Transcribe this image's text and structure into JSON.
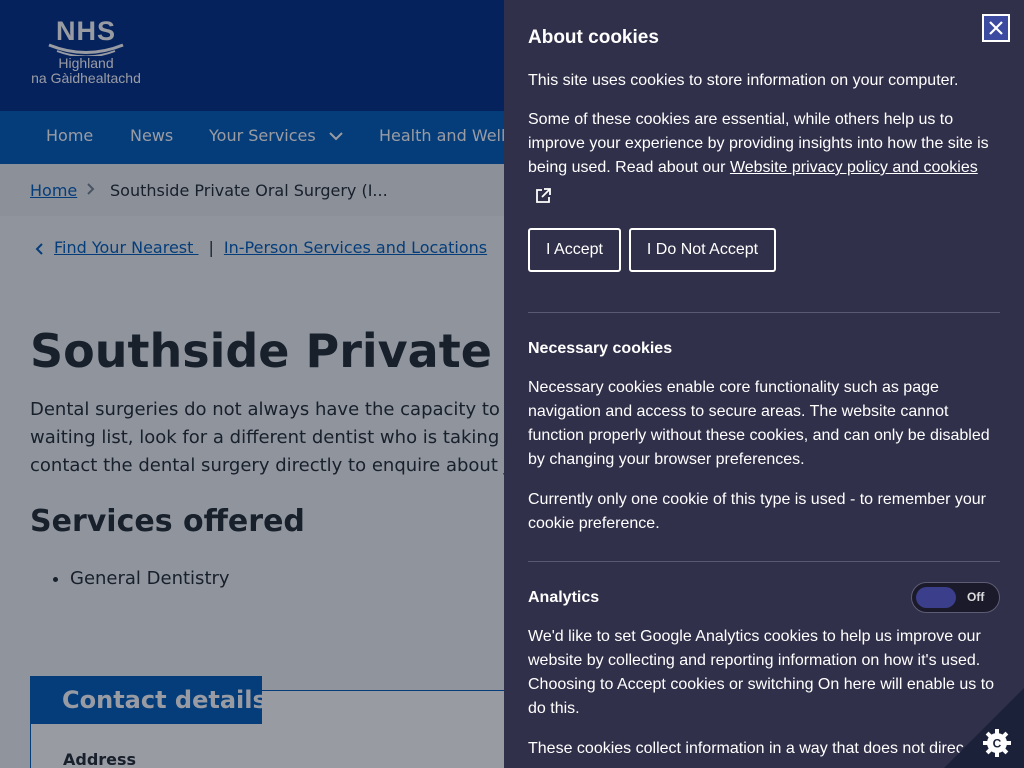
{
  "logo": {
    "line1": "NHS",
    "line2": "Highland",
    "line3": "na Gàidhealtachd"
  },
  "nav": {
    "items": [
      {
        "label": "Home"
      },
      {
        "label": "News"
      },
      {
        "label": "Your Services"
      },
      {
        "label": "Health and Wellb"
      }
    ]
  },
  "breadcrumb": {
    "home": "Home",
    "current": "Southside Private Oral Surgery (I..."
  },
  "sublinks": {
    "find_nearest": "Find Your Nearest ",
    "separator": "|",
    "in_person": "In-Person Services and Locations"
  },
  "page": {
    "title": "Southside Private Oral",
    "intro_lines": [
      "Dental surgeries do not always have the capacity to ta",
      "waiting list, look for a different dentist who is taking",
      "contact the dental surgery directly to enquire about jo"
    ],
    "services_heading": "Services offered",
    "services": [
      "General Dentistry"
    ],
    "contact_heading": "Contact details",
    "address_label": "Address"
  },
  "cookie_panel": {
    "title": "About cookies",
    "intro": "This site uses cookies to store information on your computer.",
    "essential_text": "Some of these cookies are essential, while others help us to improve your experience by providing insights into how the site is being used. Read about our ",
    "privacy_link": "Website privacy policy and cookies",
    "accept_label": "I Accept",
    "decline_label": "I Do Not Accept",
    "necessary_heading": "Necessary cookies",
    "necessary_text": "Necessary cookies enable core functionality such as page navigation and access to secure areas. The website cannot function properly without these cookies, and can only be disabled by changing your browser preferences.",
    "necessary_note": "Currently only one cookie of this type is used - to remember your cookie preference.",
    "analytics_heading": "Analytics",
    "analytics_toggle": "Off",
    "analytics_text": "We'd like to set Google Analytics cookies to help us improve our website by collecting and reporting information on how it's used. Choosing to Accept cookies or switching On here will enable us to do this.",
    "analytics_more": "These cookies collect information in a way that does not direc"
  },
  "colors": {
    "nhs_dark_blue": "#003087",
    "nhs_blue": "#005eb8",
    "panel_bg": "#31304a"
  },
  "icons": {
    "close": "close-icon",
    "external": "external-link-icon",
    "cookie": "cookie-settings-icon"
  }
}
